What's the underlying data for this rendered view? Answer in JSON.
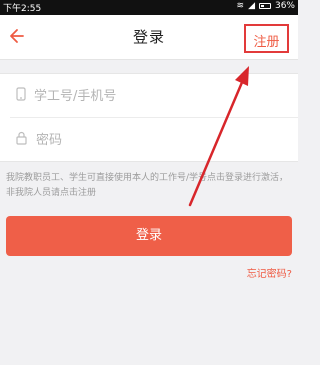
{
  "status_bar": {
    "time": "下午2:55",
    "battery": "36%"
  },
  "header": {
    "back_icon": "left-arrow-icon",
    "title": "登录",
    "register_label": "注册"
  },
  "form": {
    "account_placeholder": "学工号/手机号",
    "password_placeholder": "密码"
  },
  "hint_text": "我院教职员工、学生可直接使用本人的工作号/学号点击登录进行激活，非我院人员请点击注册",
  "login_button_label": "登录",
  "forgot_password_label": "忘记密码?",
  "colors": {
    "accent": "#ef5f48",
    "annotation_red": "#d8262b"
  }
}
